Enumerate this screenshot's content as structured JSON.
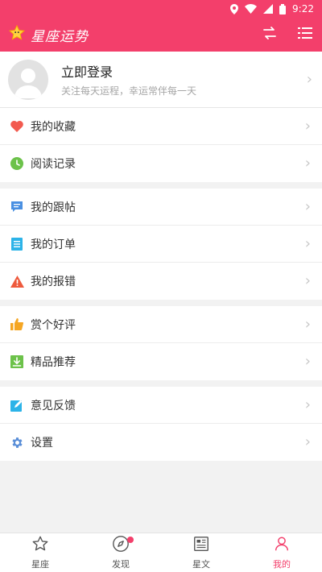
{
  "status_bar": {
    "time": "9:22"
  },
  "app_bar": {
    "title": "星座运势",
    "actions": [
      "switch-icon",
      "list-icon"
    ]
  },
  "profile": {
    "title": "立即登录",
    "subtitle": "关注每天运程，幸运常伴每一天"
  },
  "groups": [
    {
      "items": [
        {
          "label": "我的收藏",
          "icon": "heart-icon"
        },
        {
          "label": "阅读记录",
          "icon": "clock-icon"
        }
      ]
    },
    {
      "items": [
        {
          "label": "我的跟帖",
          "icon": "comment-icon"
        },
        {
          "label": "我的订单",
          "icon": "order-icon"
        },
        {
          "label": "我的报错",
          "icon": "warning-icon"
        }
      ]
    },
    {
      "items": [
        {
          "label": "赏个好评",
          "icon": "thumbs-up-icon"
        },
        {
          "label": "精品推荐",
          "icon": "download-icon"
        }
      ]
    },
    {
      "items": [
        {
          "label": "意见反馈",
          "icon": "edit-icon"
        },
        {
          "label": "设置",
          "icon": "gear-icon"
        }
      ]
    }
  ],
  "tabs": [
    {
      "label": "星座",
      "icon": "star-icon",
      "active": false
    },
    {
      "label": "发现",
      "icon": "compass-icon",
      "active": false,
      "badge": true
    },
    {
      "label": "星文",
      "icon": "newspaper-icon",
      "active": false
    },
    {
      "label": "我的",
      "icon": "user-icon",
      "active": true
    }
  ],
  "colors": {
    "accent": "#f33f6b",
    "heart": "#f25a4f",
    "green": "#6cc24a",
    "blue": "#4a90e2",
    "cyan": "#2cb3e8",
    "warning": "#ee5a3d",
    "orange": "#f5a623",
    "gear": "#5b8fd8"
  }
}
